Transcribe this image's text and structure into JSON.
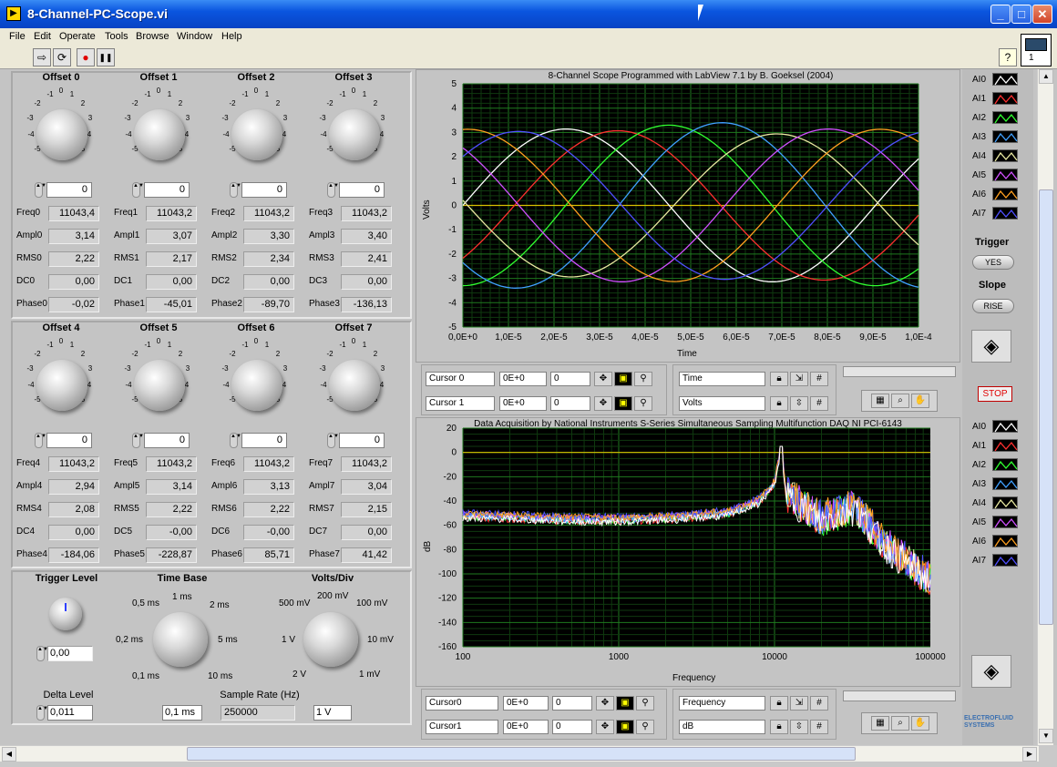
{
  "window": {
    "title": "8-Channel-PC-Scope.vi",
    "min": "_",
    "max": "□",
    "close": "✕"
  },
  "menu": [
    "File",
    "Edit",
    "Operate",
    "Tools",
    "Browse",
    "Window",
    "Help"
  ],
  "toolbar": {
    "run": "⇨",
    "run_cont": "⟳",
    "abort": "●",
    "pause": "❚❚",
    "help": "?",
    "vi_icon_num": "1"
  },
  "knob_ticks": [
    "-1",
    "0",
    "1",
    "-2",
    "2",
    "-3",
    "3",
    "-4",
    "4",
    "-5",
    "5"
  ],
  "offsets": [
    {
      "label": "Offset 0",
      "value": "0",
      "freq_l": "Freq0",
      "freq": "11043,4",
      "ampl_l": "Ampl0",
      "ampl": "3,14",
      "rms_l": "RMS0",
      "rms": "2,22",
      "dc_l": "DC0",
      "dc": "0,00",
      "ph_l": "Phase0",
      "ph": "-0,02"
    },
    {
      "label": "Offset 1",
      "value": "0",
      "freq_l": "Freq1",
      "freq": "11043,2",
      "ampl_l": "Ampl1",
      "ampl": "3,07",
      "rms_l": "RMS1",
      "rms": "2,17",
      "dc_l": "DC1",
      "dc": "0,00",
      "ph_l": "Phase1",
      "ph": "-45,01"
    },
    {
      "label": "Offset 2",
      "value": "0",
      "freq_l": "Freq2",
      "freq": "11043,2",
      "ampl_l": "Ampl2",
      "ampl": "3,30",
      "rms_l": "RMS2",
      "rms": "2,34",
      "dc_l": "DC2",
      "dc": "0,00",
      "ph_l": "Phase2",
      "ph": "-89,70"
    },
    {
      "label": "Offset 3",
      "value": "0",
      "freq_l": "Freq3",
      "freq": "11043,2",
      "ampl_l": "Ampl3",
      "ampl": "3,40",
      "rms_l": "RMS3",
      "rms": "2,41",
      "dc_l": "DC3",
      "dc": "0,00",
      "ph_l": "Phase3",
      "ph": "-136,13"
    },
    {
      "label": "Offset 4",
      "value": "0",
      "freq_l": "Freq4",
      "freq": "11043,2",
      "ampl_l": "Ampl4",
      "ampl": "2,94",
      "rms_l": "RMS4",
      "rms": "2,08",
      "dc_l": "DC4",
      "dc": "0,00",
      "ph_l": "Phase4",
      "ph": "-184,06"
    },
    {
      "label": "Offset 5",
      "value": "0",
      "freq_l": "Freq5",
      "freq": "11043,2",
      "ampl_l": "Ampl5",
      "ampl": "3,14",
      "rms_l": "RMS5",
      "rms": "2,22",
      "dc_l": "DC5",
      "dc": "-0,00",
      "ph_l": "Phase5",
      "ph": "-228,87"
    },
    {
      "label": "Offset 6",
      "value": "0",
      "freq_l": "Freq6",
      "freq": "11043,2",
      "ampl_l": "Ampl6",
      "ampl": "3,13",
      "rms_l": "RMS6",
      "rms": "2,22",
      "dc_l": "DC6",
      "dc": "-0,00",
      "ph_l": "Phase6",
      "ph": "85,71"
    },
    {
      "label": "Offset 7",
      "value": "0",
      "freq_l": "Freq7",
      "freq": "11043,2",
      "ampl_l": "Ampl7",
      "ampl": "3,04",
      "rms_l": "RMS7",
      "rms": "2,15",
      "dc_l": "DC7",
      "dc": "0,00",
      "ph_l": "Phase7",
      "ph": "41,42"
    }
  ],
  "controls": {
    "trigger_level": {
      "label": "Trigger Level",
      "value": "0,00"
    },
    "delta_level": {
      "label": "Delta Level",
      "value": "0,011"
    },
    "time_base": {
      "label": "Time Base",
      "value": "0,1 ms",
      "ticks": [
        "1 ms",
        "0,5 ms",
        "2 ms",
        "0,2 ms",
        "5 ms",
        "0,1 ms",
        "10 ms"
      ]
    },
    "volts_div": {
      "label": "Volts/Div",
      "value": "1 V",
      "ticks": [
        "200 mV",
        "500 mV",
        "100 mV",
        "1 V",
        "10 mV",
        "2 V",
        "1 mV"
      ]
    },
    "sample_rate": {
      "label": "Sample Rate (Hz)",
      "value": "250000"
    }
  },
  "right": {
    "trigger": {
      "label": "Trigger",
      "value": "YES"
    },
    "slope": {
      "label": "Slope",
      "value": "RISE"
    },
    "stop": "STOP",
    "logo": "ELECTROFLUID\nSYSTEMS",
    "channels": [
      "AI0",
      "AI1",
      "AI2",
      "AI3",
      "AI4",
      "AI5",
      "AI6",
      "AI7"
    ],
    "channel_colors": [
      "#ffffff",
      "#ff3030",
      "#30ff30",
      "#40a0ff",
      "#e8e8a0",
      "#d050ff",
      "#ffa020",
      "#5050ff"
    ]
  },
  "scope": {
    "title": "8-Channel Scope Programmed with LabView 7.1 by B. Goeksel (2004)",
    "ylabel": "Volts",
    "xlabel": "Time",
    "yticks": [
      "5",
      "4",
      "3",
      "2",
      "1",
      "0",
      "-1",
      "-2",
      "-3",
      "-4",
      "-5"
    ],
    "xticks": [
      "0,0E+0",
      "1,0E-5",
      "2,0E-5",
      "3,0E-5",
      "4,0E-5",
      "5,0E-5",
      "6,0E-5",
      "7,0E-5",
      "8,0E-5",
      "9,0E-5",
      "1,0E-4"
    ],
    "cursors": [
      {
        "name": "Cursor 0",
        "x": "0E+0",
        "y": "0"
      },
      {
        "name": "Cursor 1",
        "x": "0E+0",
        "y": "0"
      }
    ],
    "scale_x": "Time",
    "scale_y": "Volts"
  },
  "spectrum": {
    "title": "Data Acquisition by National Instruments S-Series Simultaneous Sampling Multifunction DAQ  NI PCI-6143",
    "ylabel": "dB",
    "xlabel": "Frequency",
    "yticks": [
      "20",
      "0",
      "-20",
      "-40",
      "-60",
      "-80",
      "-100",
      "-120",
      "-140",
      "-160"
    ],
    "xticks": [
      "100",
      "1000",
      "10000",
      "100000"
    ],
    "cursors": [
      {
        "name": "Cursor0",
        "x": "0E+0",
        "y": "0"
      },
      {
        "name": "Cursor1",
        "x": "0E+0",
        "y": "0"
      }
    ],
    "scale_x": "Frequency",
    "scale_y": "dB"
  },
  "chart_data": [
    {
      "type": "line",
      "title": "8-Channel Scope Programmed with LabView 7.1 by B. Goeksel (2004)",
      "xlabel": "Time",
      "ylabel": "Volts",
      "xlim": [
        0,
        0.0001
      ],
      "ylim": [
        -5,
        5
      ],
      "grid": true,
      "frequency_hz": 11043.2,
      "series": [
        {
          "name": "AI0",
          "amplitude": 3.14,
          "phase_deg": -0.02
        },
        {
          "name": "AI1",
          "amplitude": 3.07,
          "phase_deg": -45.01
        },
        {
          "name": "AI2",
          "amplitude": 3.3,
          "phase_deg": -89.7
        },
        {
          "name": "AI3",
          "amplitude": 3.4,
          "phase_deg": -136.13
        },
        {
          "name": "AI4",
          "amplitude": 2.94,
          "phase_deg": -184.06
        },
        {
          "name": "AI5",
          "amplitude": 3.14,
          "phase_deg": -228.87
        },
        {
          "name": "AI6",
          "amplitude": 3.13,
          "phase_deg": 85.71
        },
        {
          "name": "AI7",
          "amplitude": 3.04,
          "phase_deg": 41.42
        }
      ],
      "reference_line_y": 0
    },
    {
      "type": "line",
      "title": "Data Acquisition by National Instruments S-Series Simultaneous Sampling Multifunction DAQ  NI PCI-6143",
      "xlabel": "Frequency",
      "ylabel": "dB",
      "xscale": "log",
      "xlim": [
        100,
        100000
      ],
      "ylim": [
        -160,
        20
      ],
      "grid": true,
      "reference_line_y": 0,
      "spectrum_points": [
        [
          100,
          -52
        ],
        [
          200,
          -53
        ],
        [
          500,
          -55
        ],
        [
          1000,
          -55
        ],
        [
          2000,
          -54
        ],
        [
          5000,
          -50
        ],
        [
          8000,
          -40
        ],
        [
          10000,
          -25
        ],
        [
          11043,
          5
        ],
        [
          12000,
          -40
        ],
        [
          20000,
          -60
        ],
        [
          33000,
          -50
        ],
        [
          50000,
          -80
        ],
        [
          100000,
          -110
        ]
      ]
    }
  ]
}
